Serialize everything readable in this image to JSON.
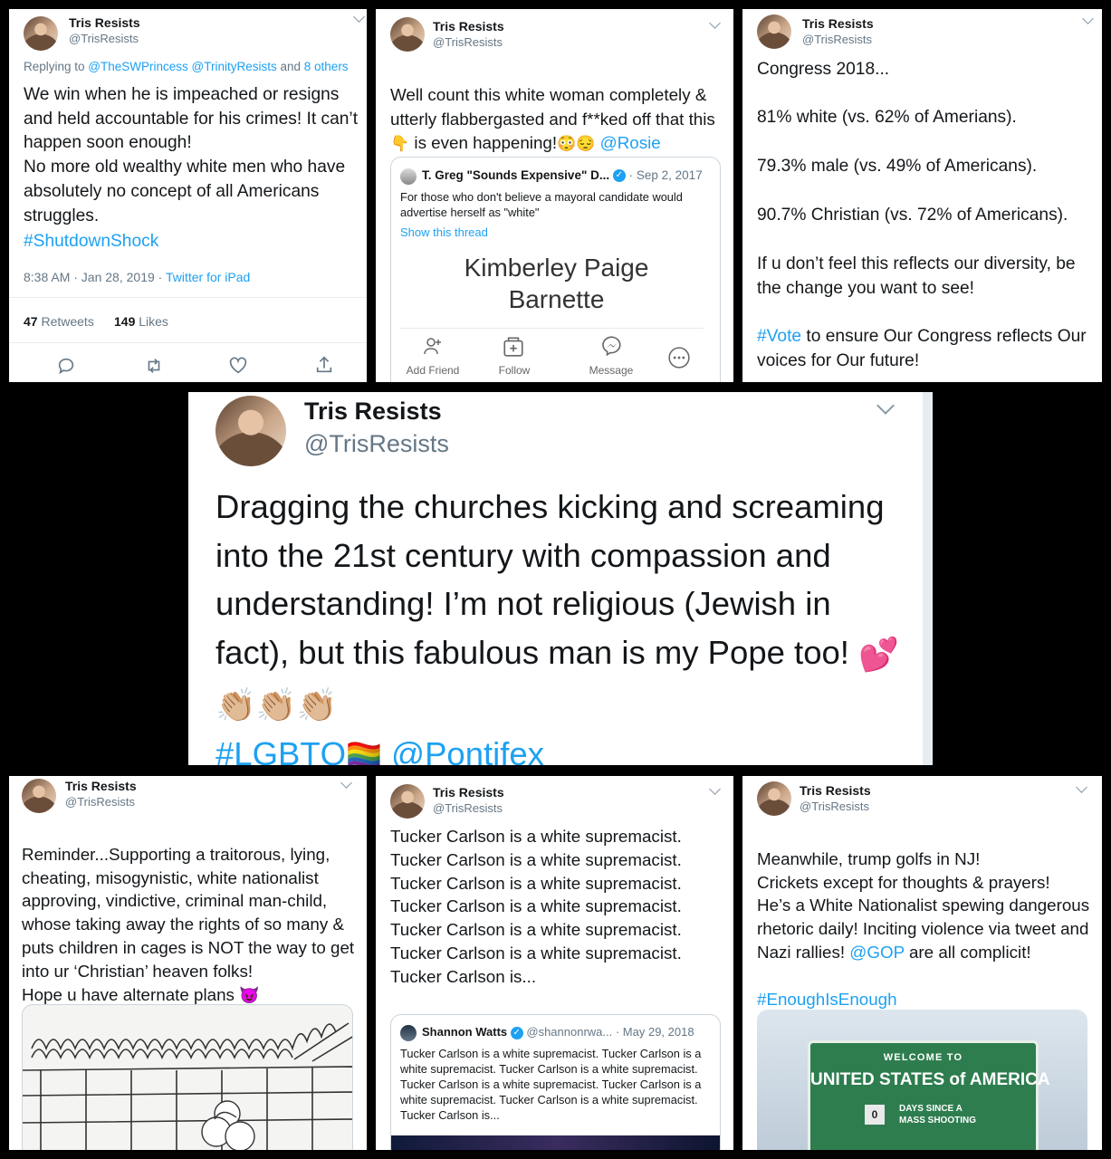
{
  "author": {
    "name": "Tris Resists",
    "handle": "@TrisResists"
  },
  "t1": {
    "replying_prefix": "Replying to ",
    "replying_targets": "@TheSWPrincess @TrinityResists",
    "replying_suffix": " and ",
    "replying_others": "8 others",
    "text": "We win when he is impeached or resigns and held accountable for his crimes! It can’t happen soon enough!\nNo more old wealthy white men who have absolutely no concept of all Americans struggles.",
    "hashtag": "#ShutdownShock",
    "time": "8:38 AM · Jan 28, 2019 · ",
    "client": "Twitter for iPad",
    "retweets_count": "47",
    "retweets_label": " Retweets",
    "likes_count": "149",
    "likes_label": " Likes"
  },
  "t2": {
    "text_a": "Well count this white woman completely & utterly flabbergasted and f**ked off that this ",
    "text_b": " is even happening!",
    "mention": "@Rosie",
    "quote_name": "T. Greg \"Sounds Expensive\" D...",
    "quote_date": "· Sep 2, 2017",
    "quote_text": "For those who don't believe a mayoral candidate would advertise herself as \"white\"",
    "show_thread": "Show this thread",
    "fb_name": "Kimberley Paige\nBarnette",
    "fb_actions": [
      "Add Friend",
      "Follow",
      "Message"
    ]
  },
  "t3": {
    "p1": "Congress 2018...",
    "p2": "81% white (vs. 62% of Amerians).",
    "p3": "79.3% male (vs. 49% of Americans).",
    "p4": "90.7% Christian (vs. 72% of Americans).",
    "p5": "If u don’t feel this reflects our diversity, be the change you want to see!",
    "hashtag": "#Vote",
    "p6": " to ensure Our Congress reflects Our voices for Our future!"
  },
  "t4": {
    "text": "Dragging the churches kicking and screaming into the 21st century with compassion and understanding! I’m not religious (Jewish in fact), but this fabulous man is my Pope too! ",
    "hashtag": "#LGBTQ",
    "mention": "@Pontifex"
  },
  "t5": {
    "text": "Reminder...Supporting a traitorous, lying, cheating, misogynistic, white nationalist approving, vindictive, criminal man-child, whose taking away the rights of so many & puts children in cages is NOT the way to get into ur ‘Christian’ heaven folks!\nHope u have alternate plans "
  },
  "t6": {
    "lines": [
      "Tucker Carlson is a white supremacist.",
      "Tucker Carlson is a white supremacist.",
      "Tucker Carlson is a white supremacist.",
      "Tucker Carlson is a white supremacist.",
      "Tucker Carlson is a white supremacist.",
      "Tucker Carlson is a white supremacist.",
      "Tucker Carlson is..."
    ],
    "quote_name": "Shannon Watts",
    "quote_handle": "@shannonrwa...",
    "quote_date": "· May 29, 2018",
    "quote_text": "Tucker Carlson is a white supremacist. Tucker Carlson is a white supremacist. Tucker Carlson is a white supremacist. Tucker Carlson is a white supremacist. Tucker Carlson is a white supremacist. Tucker Carlson is a white supremacist.  Tucker Carlson is..."
  },
  "t7": {
    "text_a": "Meanwhile, trump golfs in NJ!\nCrickets except for thoughts & prayers!\nHe’s a White Nationalist spewing dangerous rhetoric daily! Inciting violence via tweet and Nazi rallies! ",
    "mention": "@GOP",
    "text_b": " are all complicit!",
    "hashtag": "#EnoughIsEnough",
    "sign_welcome": "WELCOME TO",
    "sign_title": "UNITED STATES of AMERICA",
    "sign_counter": "0",
    "sign_days": "DAYS SINCE A\nMASS SHOOTING"
  },
  "colors": {
    "link": "#1da1f2",
    "muted": "#657786",
    "sign_green": "#2e7d4f"
  }
}
